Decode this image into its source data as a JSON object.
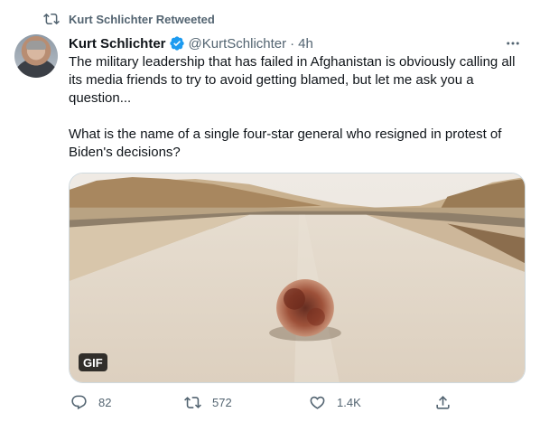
{
  "retweet_context": {
    "label": "Kurt Schlichter Retweeted"
  },
  "author": {
    "name": "Kurt Schlichter",
    "handle": "@KurtSchlichter",
    "separator": "·",
    "time": "4h",
    "verified": true
  },
  "tweet": {
    "paragraph_1": "The military leadership that has failed in Afghanistan is obviously calling all its media friends to try to avoid getting blamed, but let me ask you a question...",
    "paragraph_2": "What is the name of a single four-star general who resigned in protest of Biden's decisions?"
  },
  "media": {
    "badge": "GIF"
  },
  "actions": {
    "replies": "82",
    "retweets": "572",
    "likes": "1.4K"
  },
  "icons": {
    "retweet_context": "retweet-icon",
    "verified": "verified-badge-icon",
    "more": "more-options-icon",
    "reply": "reply-icon",
    "retweet": "retweet-icon",
    "like": "heart-icon",
    "share": "share-icon"
  },
  "colors": {
    "text_primary": "#0f1419",
    "text_secondary": "#536471",
    "verified_blue": "#1d9bf0",
    "border": "#cfd9de"
  }
}
